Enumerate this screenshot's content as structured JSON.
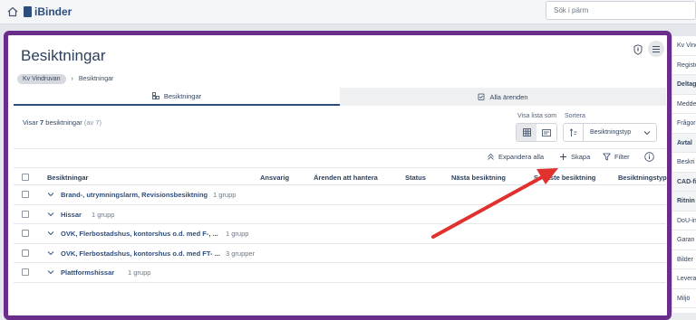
{
  "app": {
    "logo_text": "iBinder",
    "search_placeholder": "Sök i pärm"
  },
  "page": {
    "title": "Besiktningar"
  },
  "breadcrumb": {
    "root": "Kv Vindruvan",
    "current": "Besiktningar"
  },
  "tabs": [
    {
      "label": "Besiktningar",
      "active": true
    },
    {
      "label": "Alla ärenden",
      "active": false
    }
  ],
  "summary": {
    "prefix": "Visar ",
    "count": "7",
    "noun": " besiktningar",
    "total": "(av 7)"
  },
  "controls": {
    "view_label": "Visa lista som",
    "sort_label": "Sortera",
    "sort_value": "Besiktningstyp"
  },
  "toolbar": {
    "expand_all": "Expandera alla",
    "create": "Skapa",
    "filter": "Filter"
  },
  "table": {
    "columns": [
      "Besiktningar",
      "Ansvarig",
      "Ärenden att hantera",
      "Status",
      "Nästa besiktning",
      "Senaste besiktning",
      "Besiktningstyp"
    ],
    "rows": [
      {
        "name": "Brand-, utrymningslarm, Revisionsbesiktning",
        "meta": "1 grupp"
      },
      {
        "name": "Hissar",
        "meta": "1 grupp"
      },
      {
        "name": "OVK, Flerbostadshus, kontorshus o.d. med F-, ...",
        "meta": "1 grupp"
      },
      {
        "name": "OVK, Flerbostadshus, kontorshus o.d. med FT- ...",
        "meta": "3 grupper"
      },
      {
        "name": "Plattformshissar",
        "meta": "1 grupp"
      }
    ]
  },
  "right_panel": {
    "items": [
      {
        "label": "Kv Vindr",
        "bold": false
      },
      {
        "label": "Registe",
        "bold": false
      },
      {
        "label": "Deltag",
        "bold": true
      },
      {
        "label": "Medde",
        "bold": false
      },
      {
        "label": "Frågor",
        "bold": false
      },
      {
        "label": "Avtal",
        "bold": true
      },
      {
        "label": "Beskri",
        "bold": false
      },
      {
        "label": "CAD-fi",
        "bold": true
      },
      {
        "label": "Ritnin",
        "bold": true
      },
      {
        "label": "DoU-in",
        "bold": false
      },
      {
        "label": "Garan",
        "bold": false
      },
      {
        "label": "Bilder",
        "bold": false
      },
      {
        "label": "Levera",
        "bold": false
      },
      {
        "label": "Miljö",
        "bold": false
      }
    ]
  },
  "colors": {
    "frame": "#6b2d8c",
    "accent": "#2d4d7c",
    "annotation_arrow": "#e0312f"
  }
}
